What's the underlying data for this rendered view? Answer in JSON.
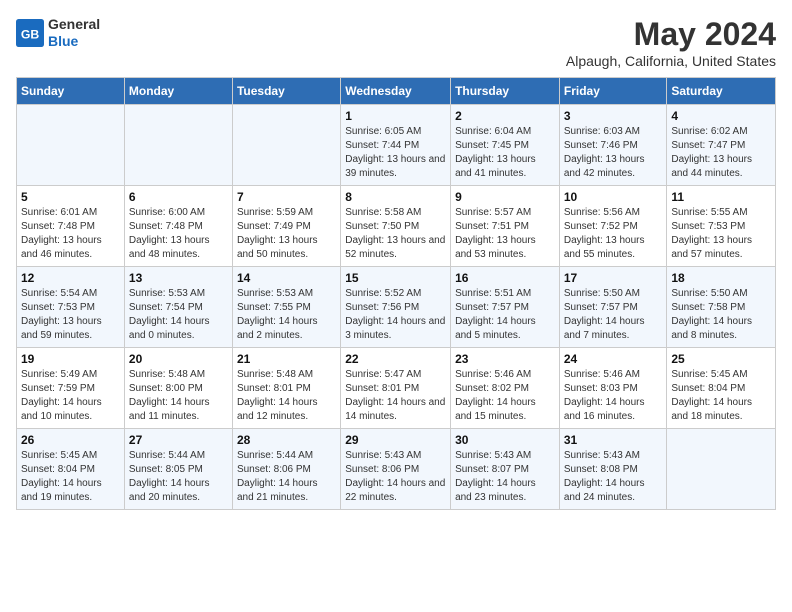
{
  "logo": {
    "general": "General",
    "blue": "Blue"
  },
  "header": {
    "title": "May 2024",
    "location": "Alpaugh, California, United States"
  },
  "weekdays": [
    "Sunday",
    "Monday",
    "Tuesday",
    "Wednesday",
    "Thursday",
    "Friday",
    "Saturday"
  ],
  "weeks": [
    [
      {
        "day": "",
        "sunrise": "",
        "sunset": "",
        "daylight": ""
      },
      {
        "day": "",
        "sunrise": "",
        "sunset": "",
        "daylight": ""
      },
      {
        "day": "",
        "sunrise": "",
        "sunset": "",
        "daylight": ""
      },
      {
        "day": "1",
        "sunrise": "Sunrise: 6:05 AM",
        "sunset": "Sunset: 7:44 PM",
        "daylight": "Daylight: 13 hours and 39 minutes."
      },
      {
        "day": "2",
        "sunrise": "Sunrise: 6:04 AM",
        "sunset": "Sunset: 7:45 PM",
        "daylight": "Daylight: 13 hours and 41 minutes."
      },
      {
        "day": "3",
        "sunrise": "Sunrise: 6:03 AM",
        "sunset": "Sunset: 7:46 PM",
        "daylight": "Daylight: 13 hours and 42 minutes."
      },
      {
        "day": "4",
        "sunrise": "Sunrise: 6:02 AM",
        "sunset": "Sunset: 7:47 PM",
        "daylight": "Daylight: 13 hours and 44 minutes."
      }
    ],
    [
      {
        "day": "5",
        "sunrise": "Sunrise: 6:01 AM",
        "sunset": "Sunset: 7:48 PM",
        "daylight": "Daylight: 13 hours and 46 minutes."
      },
      {
        "day": "6",
        "sunrise": "Sunrise: 6:00 AM",
        "sunset": "Sunset: 7:48 PM",
        "daylight": "Daylight: 13 hours and 48 minutes."
      },
      {
        "day": "7",
        "sunrise": "Sunrise: 5:59 AM",
        "sunset": "Sunset: 7:49 PM",
        "daylight": "Daylight: 13 hours and 50 minutes."
      },
      {
        "day": "8",
        "sunrise": "Sunrise: 5:58 AM",
        "sunset": "Sunset: 7:50 PM",
        "daylight": "Daylight: 13 hours and 52 minutes."
      },
      {
        "day": "9",
        "sunrise": "Sunrise: 5:57 AM",
        "sunset": "Sunset: 7:51 PM",
        "daylight": "Daylight: 13 hours and 53 minutes."
      },
      {
        "day": "10",
        "sunrise": "Sunrise: 5:56 AM",
        "sunset": "Sunset: 7:52 PM",
        "daylight": "Daylight: 13 hours and 55 minutes."
      },
      {
        "day": "11",
        "sunrise": "Sunrise: 5:55 AM",
        "sunset": "Sunset: 7:53 PM",
        "daylight": "Daylight: 13 hours and 57 minutes."
      }
    ],
    [
      {
        "day": "12",
        "sunrise": "Sunrise: 5:54 AM",
        "sunset": "Sunset: 7:53 PM",
        "daylight": "Daylight: 13 hours and 59 minutes."
      },
      {
        "day": "13",
        "sunrise": "Sunrise: 5:53 AM",
        "sunset": "Sunset: 7:54 PM",
        "daylight": "Daylight: 14 hours and 0 minutes."
      },
      {
        "day": "14",
        "sunrise": "Sunrise: 5:53 AM",
        "sunset": "Sunset: 7:55 PM",
        "daylight": "Daylight: 14 hours and 2 minutes."
      },
      {
        "day": "15",
        "sunrise": "Sunrise: 5:52 AM",
        "sunset": "Sunset: 7:56 PM",
        "daylight": "Daylight: 14 hours and 3 minutes."
      },
      {
        "day": "16",
        "sunrise": "Sunrise: 5:51 AM",
        "sunset": "Sunset: 7:57 PM",
        "daylight": "Daylight: 14 hours and 5 minutes."
      },
      {
        "day": "17",
        "sunrise": "Sunrise: 5:50 AM",
        "sunset": "Sunset: 7:57 PM",
        "daylight": "Daylight: 14 hours and 7 minutes."
      },
      {
        "day": "18",
        "sunrise": "Sunrise: 5:50 AM",
        "sunset": "Sunset: 7:58 PM",
        "daylight": "Daylight: 14 hours and 8 minutes."
      }
    ],
    [
      {
        "day": "19",
        "sunrise": "Sunrise: 5:49 AM",
        "sunset": "Sunset: 7:59 PM",
        "daylight": "Daylight: 14 hours and 10 minutes."
      },
      {
        "day": "20",
        "sunrise": "Sunrise: 5:48 AM",
        "sunset": "Sunset: 8:00 PM",
        "daylight": "Daylight: 14 hours and 11 minutes."
      },
      {
        "day": "21",
        "sunrise": "Sunrise: 5:48 AM",
        "sunset": "Sunset: 8:01 PM",
        "daylight": "Daylight: 14 hours and 12 minutes."
      },
      {
        "day": "22",
        "sunrise": "Sunrise: 5:47 AM",
        "sunset": "Sunset: 8:01 PM",
        "daylight": "Daylight: 14 hours and 14 minutes."
      },
      {
        "day": "23",
        "sunrise": "Sunrise: 5:46 AM",
        "sunset": "Sunset: 8:02 PM",
        "daylight": "Daylight: 14 hours and 15 minutes."
      },
      {
        "day": "24",
        "sunrise": "Sunrise: 5:46 AM",
        "sunset": "Sunset: 8:03 PM",
        "daylight": "Daylight: 14 hours and 16 minutes."
      },
      {
        "day": "25",
        "sunrise": "Sunrise: 5:45 AM",
        "sunset": "Sunset: 8:04 PM",
        "daylight": "Daylight: 14 hours and 18 minutes."
      }
    ],
    [
      {
        "day": "26",
        "sunrise": "Sunrise: 5:45 AM",
        "sunset": "Sunset: 8:04 PM",
        "daylight": "Daylight: 14 hours and 19 minutes."
      },
      {
        "day": "27",
        "sunrise": "Sunrise: 5:44 AM",
        "sunset": "Sunset: 8:05 PM",
        "daylight": "Daylight: 14 hours and 20 minutes."
      },
      {
        "day": "28",
        "sunrise": "Sunrise: 5:44 AM",
        "sunset": "Sunset: 8:06 PM",
        "daylight": "Daylight: 14 hours and 21 minutes."
      },
      {
        "day": "29",
        "sunrise": "Sunrise: 5:43 AM",
        "sunset": "Sunset: 8:06 PM",
        "daylight": "Daylight: 14 hours and 22 minutes."
      },
      {
        "day": "30",
        "sunrise": "Sunrise: 5:43 AM",
        "sunset": "Sunset: 8:07 PM",
        "daylight": "Daylight: 14 hours and 23 minutes."
      },
      {
        "day": "31",
        "sunrise": "Sunrise: 5:43 AM",
        "sunset": "Sunset: 8:08 PM",
        "daylight": "Daylight: 14 hours and 24 minutes."
      },
      {
        "day": "",
        "sunrise": "",
        "sunset": "",
        "daylight": ""
      }
    ]
  ]
}
